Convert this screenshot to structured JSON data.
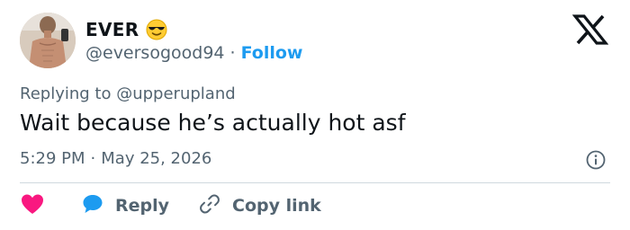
{
  "user": {
    "display_name": "EVER",
    "name_emoji": "smiling-face-with-sunglasses",
    "handle": "@eversogood94",
    "separator": "·",
    "follow_label": "Follow"
  },
  "brand": {
    "logo_icon": "x-logo-icon"
  },
  "tweet": {
    "replying_prefix": "Replying to",
    "replying_to": "@upperupland",
    "text": "Wait because he’s actually hot asf",
    "time": "5:29 PM",
    "meta_separator": "·",
    "date": "May 25, 2026"
  },
  "actions": {
    "like_icon": "heart-icon",
    "reply_icon": "speech-bubble-icon",
    "reply_label": "Reply",
    "copy_icon": "link-icon",
    "copy_label": "Copy link"
  },
  "colors": {
    "link_blue": "#1d9bf0",
    "muted_gray": "#536471",
    "like_pink": "#f91880",
    "text_dark": "#0f1419"
  }
}
